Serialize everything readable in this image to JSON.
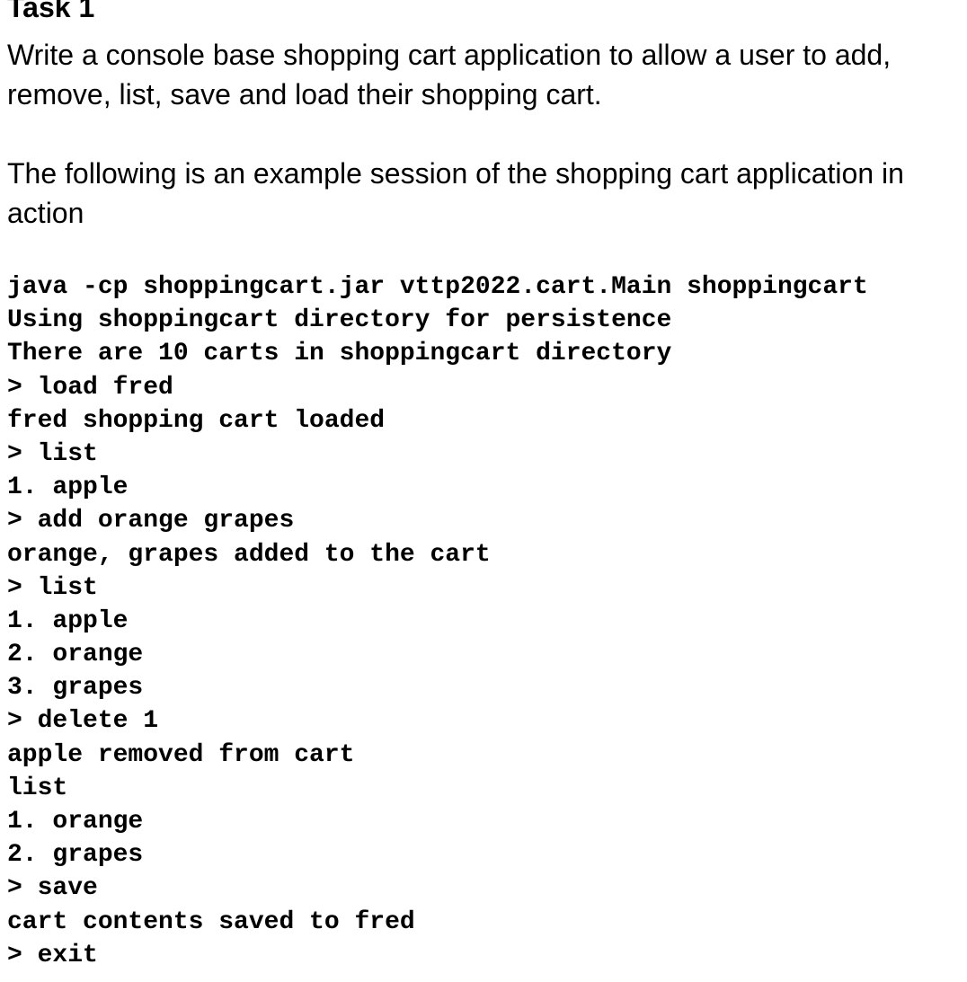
{
  "title": "Task 1",
  "intro": "Write a console base shopping cart application to allow a user to add, remove, list, save and load their shopping cart.",
  "example_intro": "The following is an example session of the shopping cart application in action",
  "session": [
    "java -cp shoppingcart.jar vttp2022.cart.Main shoppingcart",
    "Using shoppingcart directory for persistence",
    "There are 10 carts in shoppingcart directory",
    "> load fred",
    "fred shopping cart loaded",
    "> list",
    "1. apple",
    "> add orange grapes",
    "orange, grapes added to the cart",
    "> list",
    "1. apple",
    "2. orange",
    "3. grapes",
    "> delete 1",
    "apple removed from cart",
    "list",
    "1. orange",
    "2. grapes",
    "> save",
    "cart contents saved to fred",
    "> exit"
  ]
}
